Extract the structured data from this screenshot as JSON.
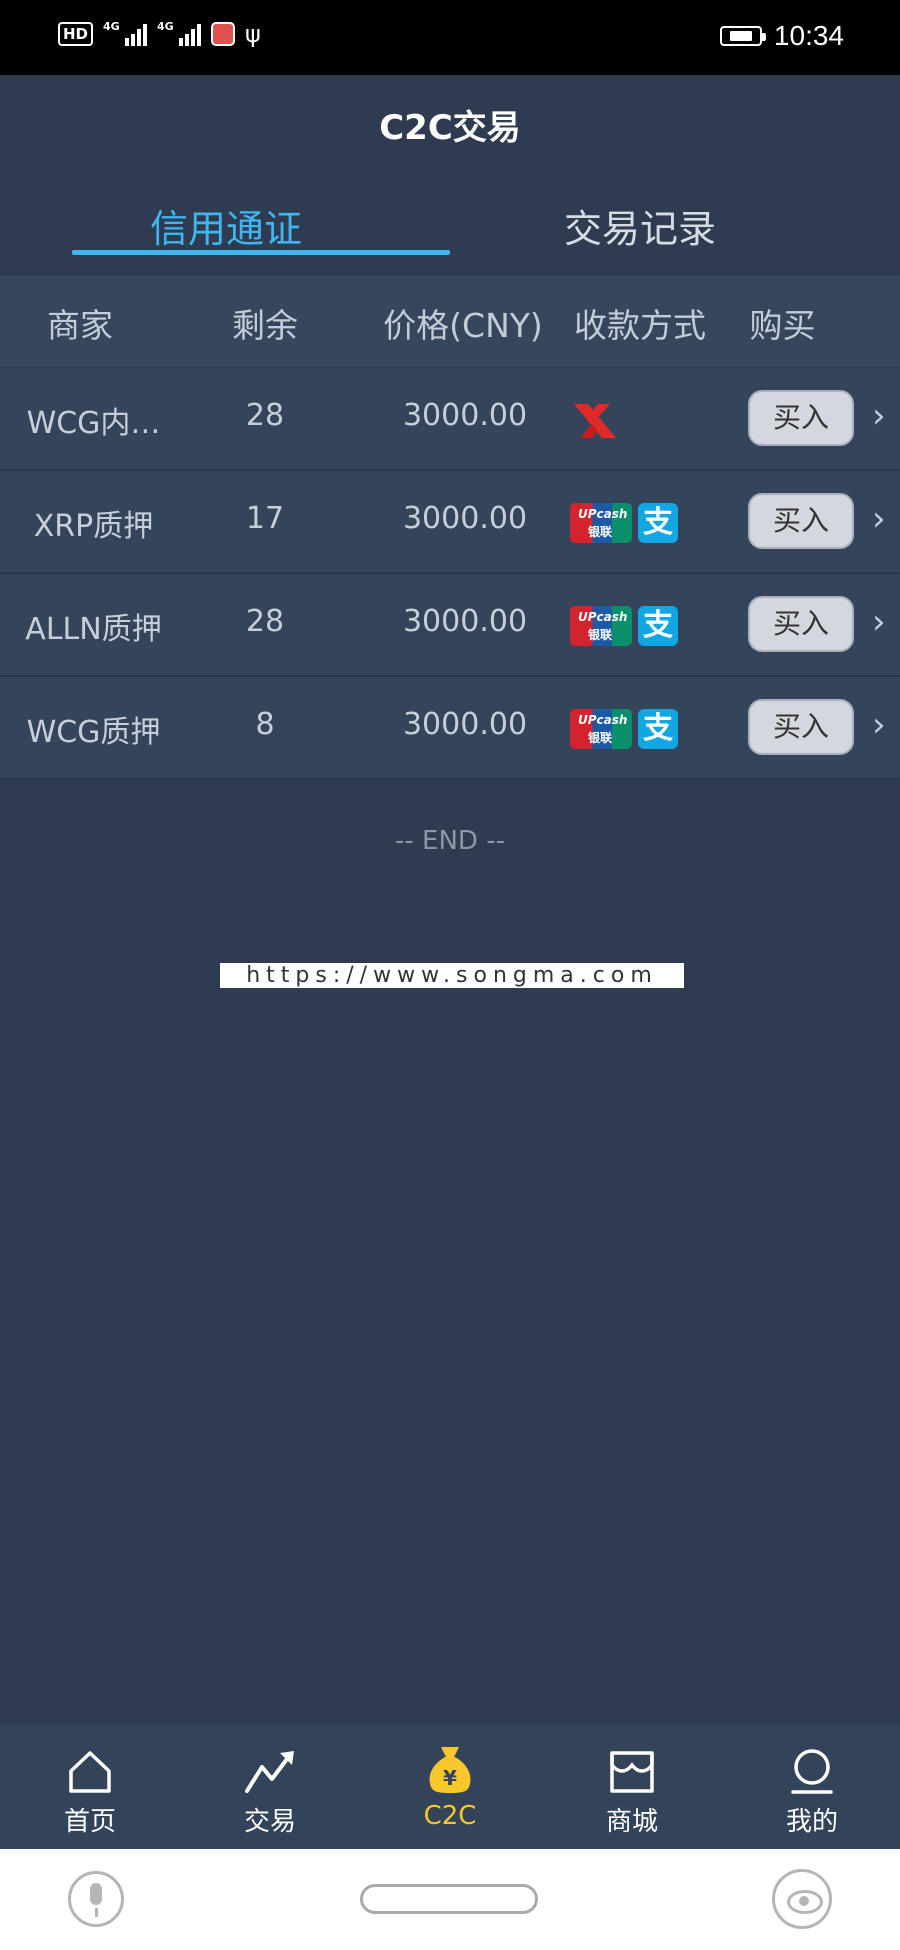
{
  "status_bar": {
    "hd_label": "HD",
    "signal1_label": "4G",
    "signal2_label": "4G",
    "time": "10:34"
  },
  "header": {
    "title": "C2C交易"
  },
  "tabs": [
    {
      "label": "信用通证",
      "active": true
    },
    {
      "label": "交易记录",
      "active": false
    }
  ],
  "table": {
    "headers": [
      "商家",
      "剩余",
      "价格(CNY)",
      "收款方式",
      "购买"
    ],
    "rows": [
      {
        "merchant": "WCG内…",
        "remaining": "28",
        "price": "3000.00",
        "payment": [
          "x-pay-icon"
        ],
        "buy_label": "买入"
      },
      {
        "merchant": "XRP质押",
        "remaining": "17",
        "price": "3000.00",
        "payment": [
          "unionpay-icon",
          "alipay-icon"
        ],
        "buy_label": "买入"
      },
      {
        "merchant": "ALLN质押",
        "remaining": "28",
        "price": "3000.00",
        "payment": [
          "unionpay-icon",
          "alipay-icon"
        ],
        "buy_label": "买入"
      },
      {
        "merchant": "WCG质押",
        "remaining": "8",
        "price": "3000.00",
        "payment": [
          "unionpay-icon",
          "alipay-icon"
        ],
        "buy_label": "买入"
      }
    ]
  },
  "payment_icons": {
    "unionpay_top": "UPcash",
    "unionpay_bottom": "银联",
    "alipay_glyph": "支"
  },
  "end_text": "-- END --",
  "watermark": "https://www.songma.com",
  "bottom_nav": [
    {
      "label": "首页",
      "icon": "home-icon",
      "active": false
    },
    {
      "label": "交易",
      "icon": "trend-icon",
      "active": false
    },
    {
      "label": "C2C",
      "icon": "money-bag-icon",
      "active": true
    },
    {
      "label": "商城",
      "icon": "store-icon",
      "active": false
    },
    {
      "label": "我的",
      "icon": "profile-icon",
      "active": false
    }
  ],
  "colors": {
    "background": "#2e3b50",
    "accent": "#3fb6f0",
    "active_nav": "#f7c72b"
  }
}
